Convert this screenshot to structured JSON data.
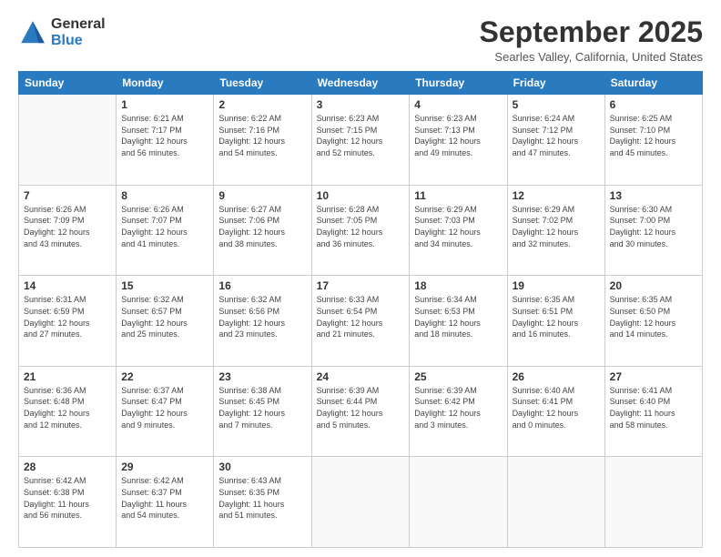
{
  "logo": {
    "general": "General",
    "blue": "Blue"
  },
  "header": {
    "month": "September 2025",
    "location": "Searles Valley, California, United States"
  },
  "weekdays": [
    "Sunday",
    "Monday",
    "Tuesday",
    "Wednesday",
    "Thursday",
    "Friday",
    "Saturday"
  ],
  "weeks": [
    [
      {
        "day": "",
        "info": ""
      },
      {
        "day": "1",
        "info": "Sunrise: 6:21 AM\nSunset: 7:17 PM\nDaylight: 12 hours\nand 56 minutes."
      },
      {
        "day": "2",
        "info": "Sunrise: 6:22 AM\nSunset: 7:16 PM\nDaylight: 12 hours\nand 54 minutes."
      },
      {
        "day": "3",
        "info": "Sunrise: 6:23 AM\nSunset: 7:15 PM\nDaylight: 12 hours\nand 52 minutes."
      },
      {
        "day": "4",
        "info": "Sunrise: 6:23 AM\nSunset: 7:13 PM\nDaylight: 12 hours\nand 49 minutes."
      },
      {
        "day": "5",
        "info": "Sunrise: 6:24 AM\nSunset: 7:12 PM\nDaylight: 12 hours\nand 47 minutes."
      },
      {
        "day": "6",
        "info": "Sunrise: 6:25 AM\nSunset: 7:10 PM\nDaylight: 12 hours\nand 45 minutes."
      }
    ],
    [
      {
        "day": "7",
        "info": "Sunrise: 6:26 AM\nSunset: 7:09 PM\nDaylight: 12 hours\nand 43 minutes."
      },
      {
        "day": "8",
        "info": "Sunrise: 6:26 AM\nSunset: 7:07 PM\nDaylight: 12 hours\nand 41 minutes."
      },
      {
        "day": "9",
        "info": "Sunrise: 6:27 AM\nSunset: 7:06 PM\nDaylight: 12 hours\nand 38 minutes."
      },
      {
        "day": "10",
        "info": "Sunrise: 6:28 AM\nSunset: 7:05 PM\nDaylight: 12 hours\nand 36 minutes."
      },
      {
        "day": "11",
        "info": "Sunrise: 6:29 AM\nSunset: 7:03 PM\nDaylight: 12 hours\nand 34 minutes."
      },
      {
        "day": "12",
        "info": "Sunrise: 6:29 AM\nSunset: 7:02 PM\nDaylight: 12 hours\nand 32 minutes."
      },
      {
        "day": "13",
        "info": "Sunrise: 6:30 AM\nSunset: 7:00 PM\nDaylight: 12 hours\nand 30 minutes."
      }
    ],
    [
      {
        "day": "14",
        "info": "Sunrise: 6:31 AM\nSunset: 6:59 PM\nDaylight: 12 hours\nand 27 minutes."
      },
      {
        "day": "15",
        "info": "Sunrise: 6:32 AM\nSunset: 6:57 PM\nDaylight: 12 hours\nand 25 minutes."
      },
      {
        "day": "16",
        "info": "Sunrise: 6:32 AM\nSunset: 6:56 PM\nDaylight: 12 hours\nand 23 minutes."
      },
      {
        "day": "17",
        "info": "Sunrise: 6:33 AM\nSunset: 6:54 PM\nDaylight: 12 hours\nand 21 minutes."
      },
      {
        "day": "18",
        "info": "Sunrise: 6:34 AM\nSunset: 6:53 PM\nDaylight: 12 hours\nand 18 minutes."
      },
      {
        "day": "19",
        "info": "Sunrise: 6:35 AM\nSunset: 6:51 PM\nDaylight: 12 hours\nand 16 minutes."
      },
      {
        "day": "20",
        "info": "Sunrise: 6:35 AM\nSunset: 6:50 PM\nDaylight: 12 hours\nand 14 minutes."
      }
    ],
    [
      {
        "day": "21",
        "info": "Sunrise: 6:36 AM\nSunset: 6:48 PM\nDaylight: 12 hours\nand 12 minutes."
      },
      {
        "day": "22",
        "info": "Sunrise: 6:37 AM\nSunset: 6:47 PM\nDaylight: 12 hours\nand 9 minutes."
      },
      {
        "day": "23",
        "info": "Sunrise: 6:38 AM\nSunset: 6:45 PM\nDaylight: 12 hours\nand 7 minutes."
      },
      {
        "day": "24",
        "info": "Sunrise: 6:39 AM\nSunset: 6:44 PM\nDaylight: 12 hours\nand 5 minutes."
      },
      {
        "day": "25",
        "info": "Sunrise: 6:39 AM\nSunset: 6:42 PM\nDaylight: 12 hours\nand 3 minutes."
      },
      {
        "day": "26",
        "info": "Sunrise: 6:40 AM\nSunset: 6:41 PM\nDaylight: 12 hours\nand 0 minutes."
      },
      {
        "day": "27",
        "info": "Sunrise: 6:41 AM\nSunset: 6:40 PM\nDaylight: 11 hours\nand 58 minutes."
      }
    ],
    [
      {
        "day": "28",
        "info": "Sunrise: 6:42 AM\nSunset: 6:38 PM\nDaylight: 11 hours\nand 56 minutes."
      },
      {
        "day": "29",
        "info": "Sunrise: 6:42 AM\nSunset: 6:37 PM\nDaylight: 11 hours\nand 54 minutes."
      },
      {
        "day": "30",
        "info": "Sunrise: 6:43 AM\nSunset: 6:35 PM\nDaylight: 11 hours\nand 51 minutes."
      },
      {
        "day": "",
        "info": ""
      },
      {
        "day": "",
        "info": ""
      },
      {
        "day": "",
        "info": ""
      },
      {
        "day": "",
        "info": ""
      }
    ]
  ]
}
